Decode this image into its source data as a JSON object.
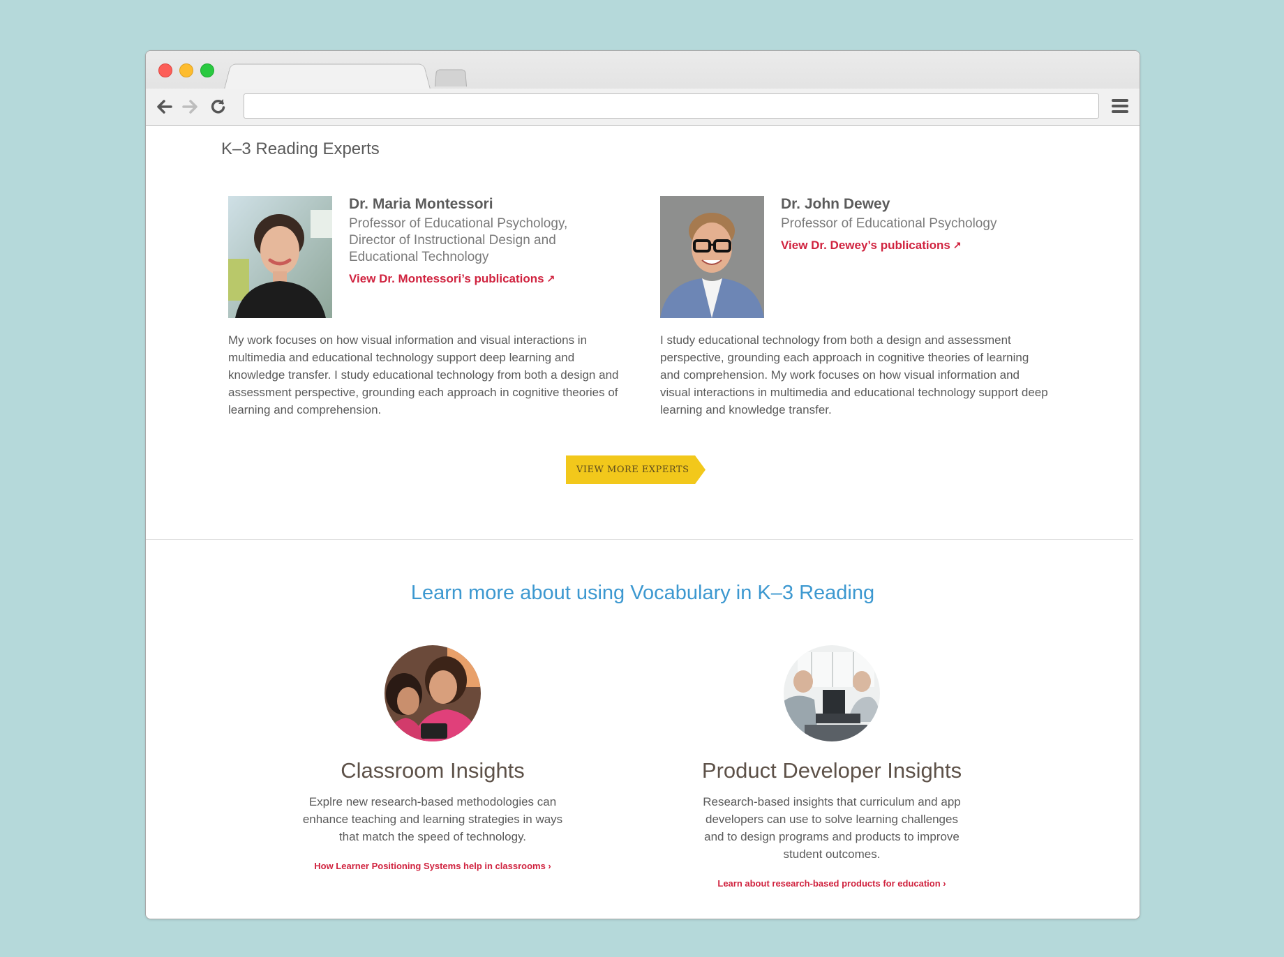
{
  "browser": {
    "address_value": "",
    "icons": [
      "back-arrow-icon",
      "forward-arrow-icon",
      "reload-icon",
      "hamburger-menu-icon"
    ]
  },
  "experts_section": {
    "title": "K–3 Reading Experts",
    "experts": [
      {
        "name": "Dr. Maria Montessori",
        "title": "Professor of Educational Psychology, Director of Instructional Design and Educational Technology",
        "link": "View Dr. Montessori’s publications",
        "bio": "My work focuses on how visual information and visual interactions in multimedia and educational technology support deep learning and knowledge transfer. I study educational technology from both a design and assessment perspective, grounding each approach in cognitive theories of learning and comprehension."
      },
      {
        "name": "Dr. John Dewey",
        "title": "Professor of Educational Psychology",
        "link": "View Dr. Dewey’s publications",
        "bio": "I study educational technology from both a design and assessment perspective, grounding each approach in cognitive theories of learning and comprehension. My work focuses on how visual information and visual interactions in multimedia and educational technology support deep learning and knowledge transfer."
      }
    ],
    "more_button": "VIEW MORE EXPERTS"
  },
  "learn_section": {
    "title": "Learn more about using Vocabulary in K–3 Reading",
    "cards": [
      {
        "title": "Classroom Insights",
        "description": "Explre new research-based methodologies can enhance teaching and learning strategies in ways that match the speed of technology.",
        "link": "How Learner Positioning Systems help in classrooms ›"
      },
      {
        "title": "Product Developer Insights",
        "description": "Research-based insights that curriculum and app developers can use to solve learning challenges and to design programs and products to improve student outcomes.",
        "link": "Learn about research-based products for education ›"
      }
    ]
  },
  "colors": {
    "background": "#b5d9da",
    "link_red": "#d0233f",
    "heading_blue": "#3c98d0",
    "button_yellow": "#f2c81b"
  }
}
